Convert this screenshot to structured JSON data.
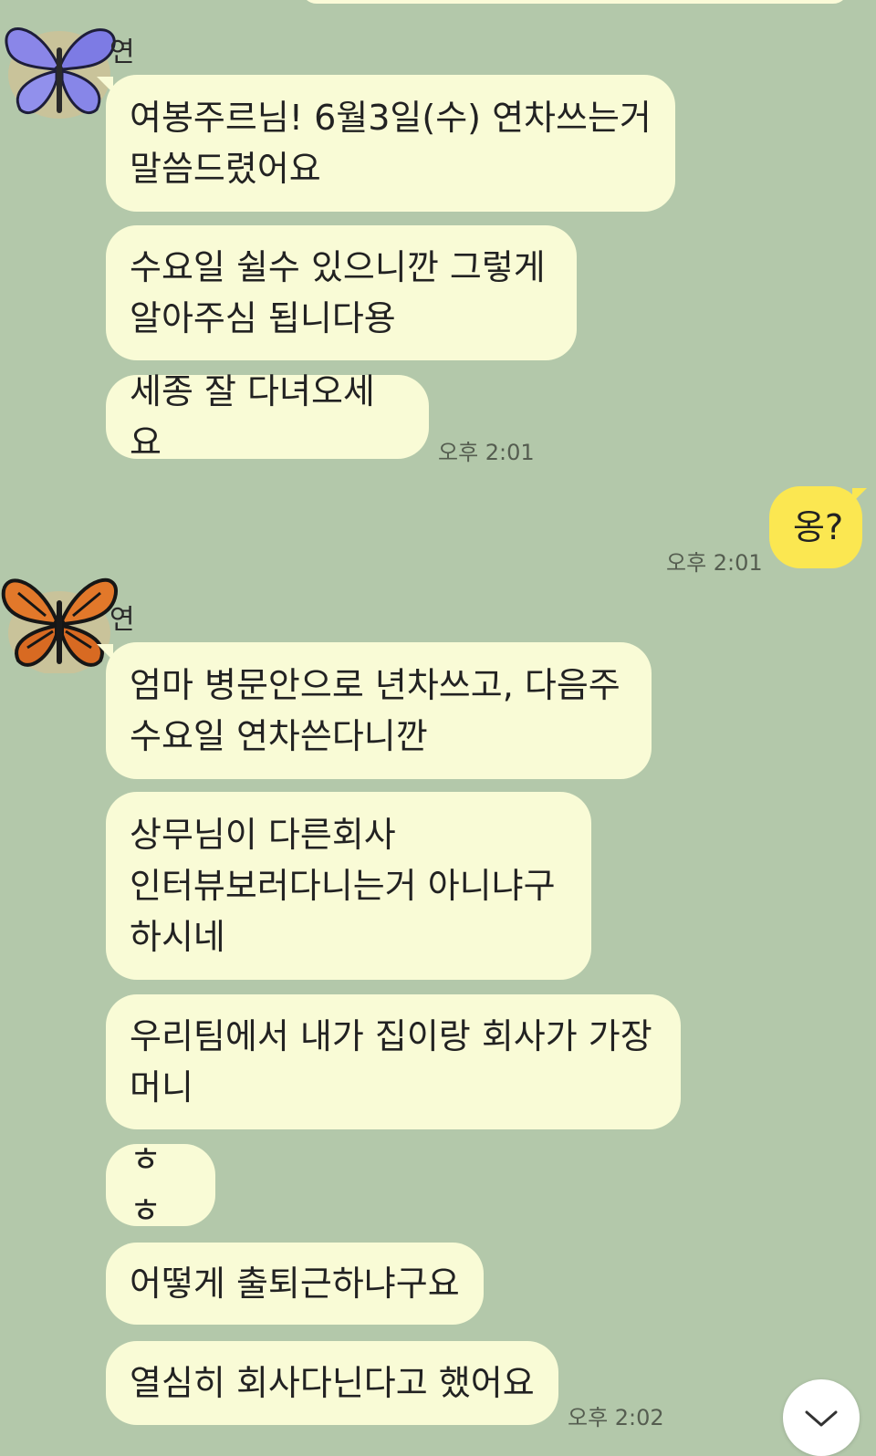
{
  "chat": {
    "partner_name_fragment": "연",
    "messages": [
      {
        "side": "left",
        "text": "여봉주르님! 6월3일(수) 연차쓰는거\n말씀드렸어요"
      },
      {
        "side": "left",
        "text": "수요일 쉴수 있으니깐 그렇게\n알아주심 됩니다용"
      },
      {
        "side": "left",
        "text": "세종 잘 다녀오세요",
        "time": "오후 2:01"
      },
      {
        "side": "right",
        "text": "옹?",
        "time": "오후 2:01"
      },
      {
        "side": "left",
        "text": "엄마 병문안으로 년차쓰고, 다음주\n수요일 연차쓴다니깐"
      },
      {
        "side": "left",
        "text": "상무님이 다른회사\n인터뷰보러다니는거 아니냐구\n하시네"
      },
      {
        "side": "left",
        "text": "우리팀에서 내가 집이랑 회사가 가장\n머니"
      },
      {
        "side": "left",
        "text": "ㅎㅎ"
      },
      {
        "side": "left",
        "text": "어떻게 출퇴근하냐구요"
      },
      {
        "side": "left",
        "text": "열심히 회사다닌다고 했어요",
        "time": "오후 2:02"
      }
    ],
    "avatars": [
      {
        "icon": "blue-butterfly-icon",
        "color": "#7f7ee0"
      },
      {
        "icon": "monarch-butterfly-icon",
        "color": "#e07a2a"
      }
    ]
  },
  "colors": {
    "background": "#b3c8aa",
    "incoming_bubble": "#f9fbd6",
    "outgoing_bubble": "#fbe751"
  },
  "scroll_button": {
    "icon": "chevron-down-icon"
  }
}
